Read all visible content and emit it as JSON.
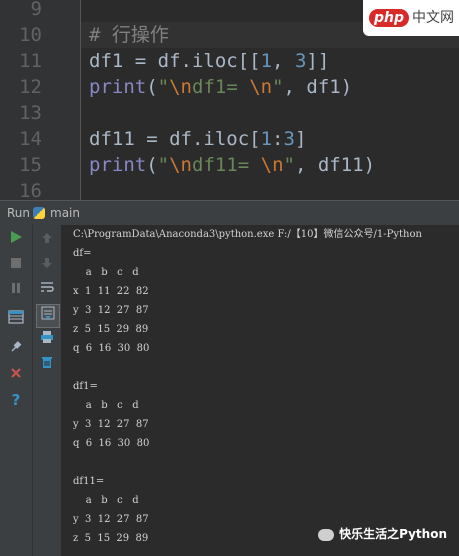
{
  "editor": {
    "line_numbers": [
      "9",
      "10",
      "11",
      "12",
      "13",
      "14",
      "15",
      "16"
    ],
    "lines": {
      "l10": {
        "comment": "# 行操作"
      },
      "l11": {
        "p1": "df1 = df.iloc[[",
        "n1": "1",
        "p2": ", ",
        "n2": "3",
        "p3": "]]"
      },
      "l12": {
        "fn": "print",
        "p1": "(",
        "s1": "\"",
        "e1": "\\n",
        "s2": "df1= ",
        "e2": "\\n",
        "s3": "\"",
        "p2": ", df1)"
      },
      "l14": {
        "p1": "df11 = df.iloc[",
        "n1": "1",
        "p2": ":",
        "n2": "3",
        "p3": "]"
      },
      "l15": {
        "fn": "print",
        "p1": "(",
        "s1": "\"",
        "e1": "\\n",
        "s2": "df11= ",
        "e2": "\\n",
        "s3": "\"",
        "p2": ", df11)"
      }
    }
  },
  "badge": {
    "php": "php",
    "cn": "中文网"
  },
  "run_bar": {
    "run_label": "Run",
    "config_name": "main"
  },
  "console": {
    "command": "C:\\ProgramData\\Anaconda3\\python.exe F:/【10】微信公众号/1-Python",
    "lines": [
      "df=",
      "    a   b   c   d",
      "x  1  11  22  82",
      "y  3  12  27  87",
      "z  5  15  29  89",
      "q  6  16  30  80",
      "",
      "df1=",
      "    a   b   c   d",
      "y  3  12  27  87",
      "q  6  16  30  80",
      "",
      "df11=",
      "    a   b   c   d",
      "y  3  12  27  87",
      "z  5  15  29  89"
    ]
  },
  "watermark": {
    "text": "快乐生活之Python"
  },
  "colors": {
    "run_green": "#499c54",
    "stop_gray": "#6e6e6e",
    "close_red": "#c75450",
    "help_blue": "#3592c4"
  },
  "icons": [
    "run-icon",
    "stop-icon",
    "pause-icon",
    "layout-icon",
    "pin-icon",
    "close-icon",
    "help-icon",
    "up-arrow-icon",
    "down-arrow-icon",
    "soft-wrap-icon",
    "scroll-end-icon",
    "print-icon",
    "trash-icon"
  ]
}
